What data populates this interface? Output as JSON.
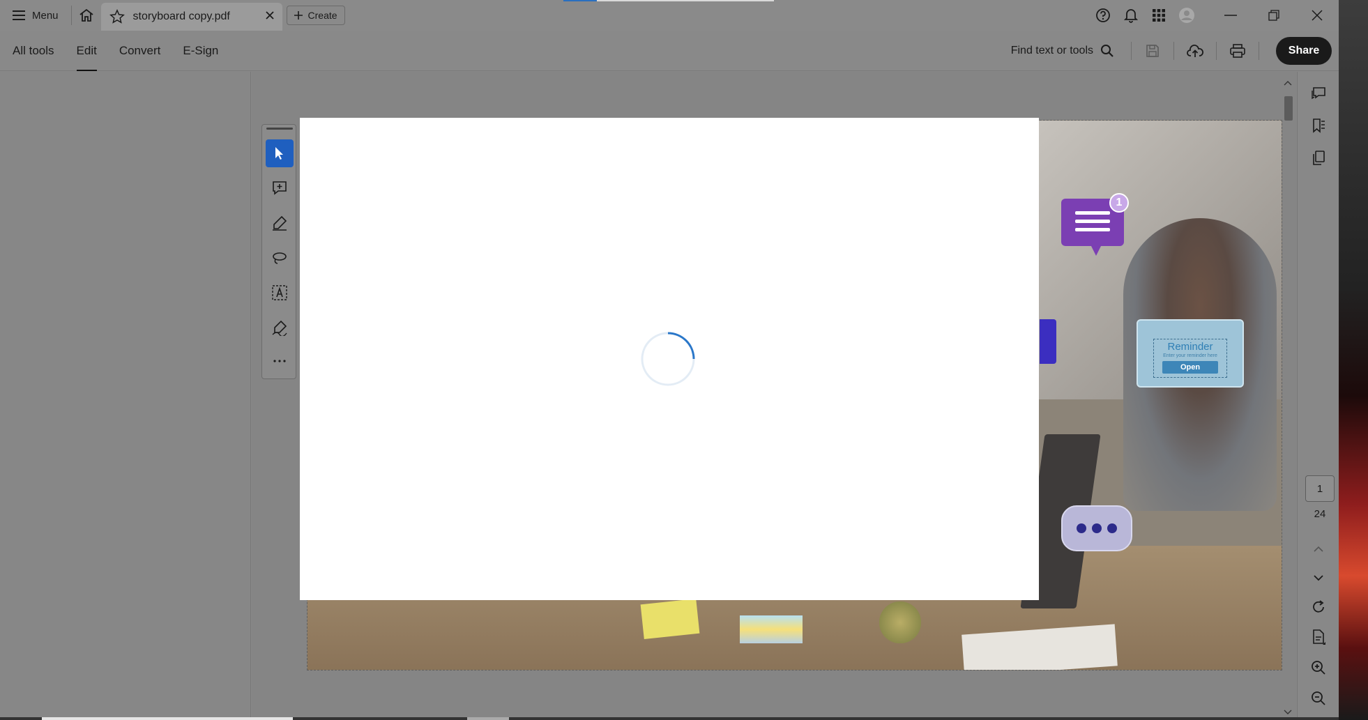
{
  "titlebar": {
    "menu_label": "Menu",
    "tab_title": "storyboard copy.pdf",
    "create_label": "Create",
    "load_progress_percent": 16
  },
  "toolbar": {
    "tabs": [
      {
        "label": "All tools",
        "active": false
      },
      {
        "label": "Edit",
        "active": true
      },
      {
        "label": "Convert",
        "active": false
      },
      {
        "label": "E-Sign",
        "active": false
      }
    ],
    "find_label": "Find text or tools",
    "share_label": "Share"
  },
  "document": {
    "badge_count": "1",
    "reminder_title": "Reminder",
    "reminder_subtitle": "Enter your reminder here",
    "reminder_button": "Open"
  },
  "pagination": {
    "current_page": "1",
    "total_pages": "24"
  },
  "colors": {
    "accent": "#1f5fbf",
    "share_bg": "#1a1a1a",
    "spinner": "#2a77c9"
  },
  "icons": {
    "floating_tools": [
      "select-arrow-icon",
      "add-comment-icon",
      "highlight-pen-icon",
      "lasso-icon",
      "text-box-icon",
      "sign-pen-icon",
      "more-icon"
    ],
    "right_rail": [
      "comments-icon",
      "bookmarks-icon",
      "pages-icon",
      "rotate-icon",
      "page-settings-icon",
      "zoom-in-icon",
      "zoom-out-icon"
    ]
  }
}
